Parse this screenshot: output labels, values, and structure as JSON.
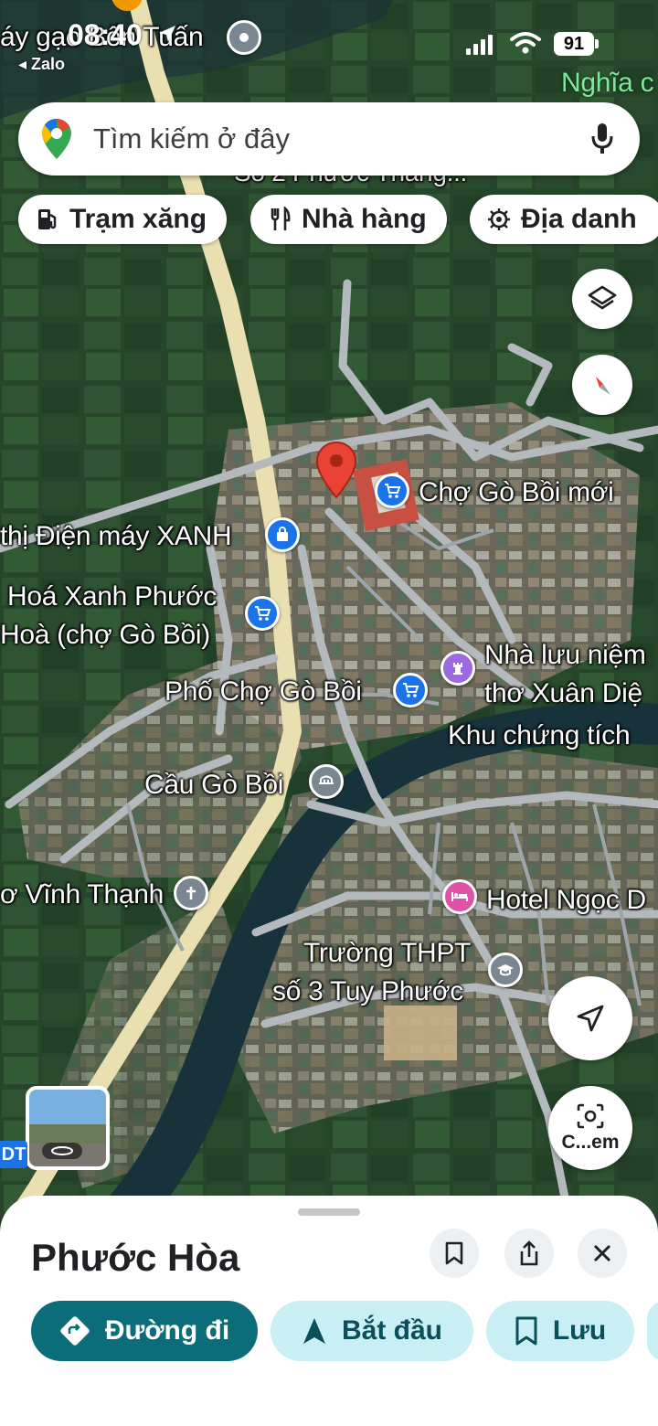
{
  "status_bar": {
    "time": "08:40",
    "back_app": "◂ Zalo",
    "battery": "91"
  },
  "map_top_labels": {
    "top_left_place": "áy gạo Bốn Tuấn",
    "top_right_place": "Nghĩa c",
    "behind_search": "Số 2 Phước Thắng..."
  },
  "search": {
    "placeholder": "Tìm kiếm ở đây"
  },
  "chips": [
    {
      "label": "Trạm xăng",
      "icon": "gas-station-icon"
    },
    {
      "label": "Nhà hàng",
      "icon": "restaurant-icon"
    },
    {
      "label": "Địa danh",
      "icon": "landmark-icon"
    }
  ],
  "map_labels": {
    "cho_go_boi_moi": "Chợ Gò Bồi mới",
    "dien_may_xanh": "thị Điện máy XANH",
    "hoa_xanh_line1": "Hoá Xanh Phước",
    "hoa_xanh_line2": "Hoà (chợ Gò Bồi)",
    "nha_luu_niem_line1": "Nhà lưu niệm",
    "nha_luu_niem_line2": "thơ Xuân Diệ",
    "pho_cho": "Phố Chợ Gò Bồi",
    "khu_chung_tich": "Khu chứng tích",
    "cau_go_boi": "Cầu Gò Bồi",
    "vinh_thanh": "ơ Vĩnh Thạnh",
    "hotel": "Hotel Ngọc D",
    "truong_line1": "Trường THPT",
    "truong_line2": "số 3 Tuy Phước",
    "road_badge": "DT"
  },
  "map_buttons": {
    "camera_label": "C...em"
  },
  "sheet": {
    "title": "Phước Hòa",
    "actions": [
      {
        "label": "Đường đi",
        "icon": "directions-icon"
      },
      {
        "label": "Bắt đầu",
        "icon": "navigation-arrow-icon"
      },
      {
        "label": "Lưu",
        "icon": "bookmark-icon"
      }
    ]
  },
  "colors": {
    "primary_teal": "#0b6d79",
    "chip_tint": "#c9eef4",
    "pin_red": "#ea4335",
    "shop_blue": "#1a73e8"
  }
}
